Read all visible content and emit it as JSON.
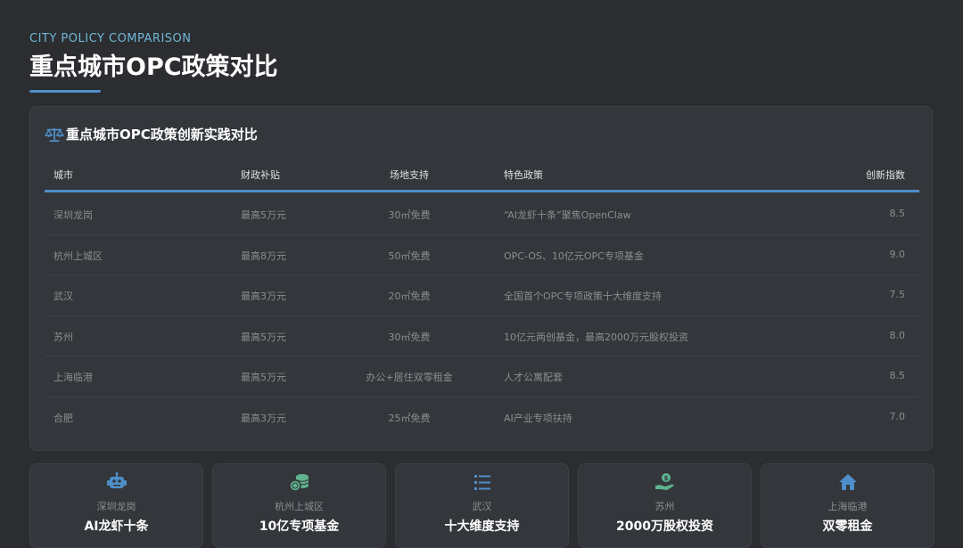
{
  "header": {
    "eyebrow": "CITY POLICY COMPARISON",
    "title": "重点城市OPC政策对比"
  },
  "panel": {
    "icon": "scale-icon",
    "title": "重点城市OPC政策创新实践对比",
    "columns": [
      "城市",
      "财政补贴",
      "场地支持",
      "特色政策",
      "创新指数"
    ],
    "rows": [
      [
        "深圳龙岗",
        "最高5万元",
        "30㎡免费",
        "“AI龙虾十条”聚焦OpenClaw",
        "8.5"
      ],
      [
        "杭州上城区",
        "最高8万元",
        "50㎡免费",
        "OPC-OS、10亿元OPC专项基金",
        "9.0"
      ],
      [
        "武汉",
        "最高3万元",
        "20㎡免费",
        "全国首个OPC专项政策十大维度支持",
        "7.5"
      ],
      [
        "苏州",
        "最高5万元",
        "30㎡免费",
        "10亿元两创基金，最高2000万元股权投资",
        "8.0"
      ],
      [
        "上海临港",
        "最高5万元",
        "办公+居住双零租金",
        "人才公寓配套",
        "8.5"
      ],
      [
        "合肥",
        "最高3万元",
        "25㎡免费",
        "AI产业专项扶持",
        "7.0"
      ]
    ]
  },
  "cards": [
    {
      "icon": "robot-icon",
      "city": "深圳龙岗",
      "label": "AI龙虾十条"
    },
    {
      "icon": "coins-icon",
      "city": "杭州上城区",
      "label": "10亿专项基金"
    },
    {
      "icon": "list-icon",
      "city": "武汉",
      "label": "十大维度支持"
    },
    {
      "icon": "hand-money-icon",
      "city": "苏州",
      "label": "2000万股权投资"
    },
    {
      "icon": "home-icon",
      "city": "上海临港",
      "label": "双零租金"
    }
  ],
  "colors": {
    "background": "#2b2d30",
    "accent": "#4f8fc9",
    "eyebrow": "#6fb8d6"
  }
}
